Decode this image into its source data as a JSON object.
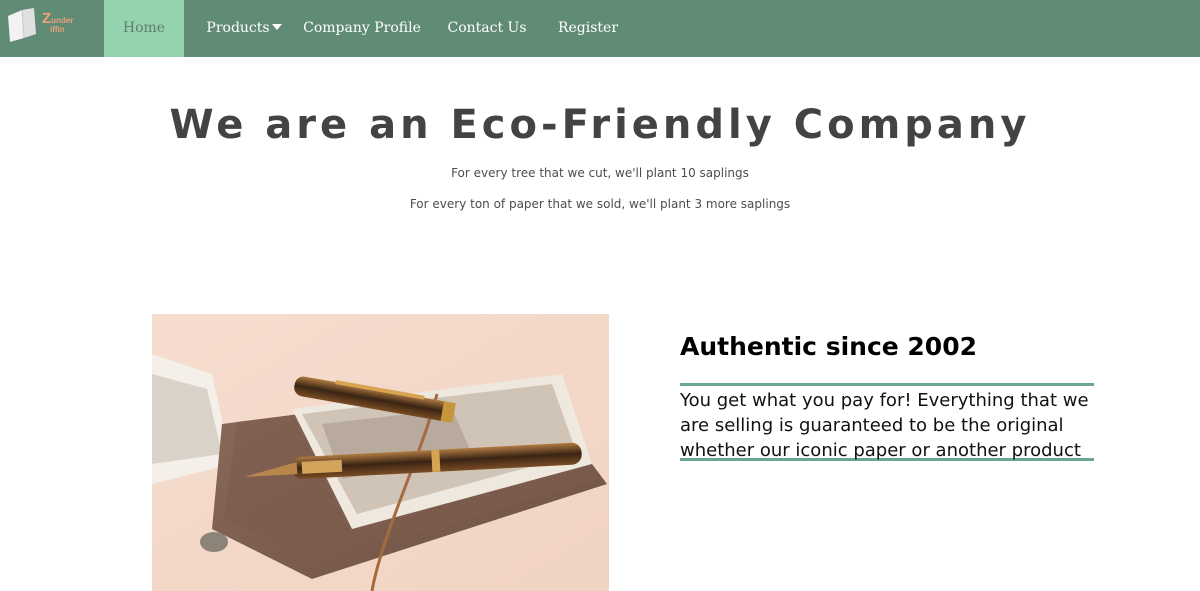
{
  "brand": {
    "logo_initial": "Z",
    "logo_line1": "under",
    "logo_line2": "iffin",
    "accent": "#608b74"
  },
  "nav": {
    "items": [
      {
        "label": "Home",
        "active": true
      },
      {
        "label": "Products",
        "dropdown": true
      },
      {
        "label": "Company Profile"
      },
      {
        "label": "Contact Us"
      },
      {
        "label": "Register"
      }
    ]
  },
  "hero": {
    "title": "We are an Eco-Friendly Company",
    "line1": "For every tree that we cut, we'll plant 10 saplings",
    "line2": "For every ton of paper that we sold, we'll plant 3 more saplings"
  },
  "feature": {
    "image_icon": "fountain-pen-notebook-photo",
    "title": "Authentic since 2002",
    "text": "You get what you pay for! Everything that we are selling is guaranteed to be the original whether our iconic paper or another product"
  }
}
